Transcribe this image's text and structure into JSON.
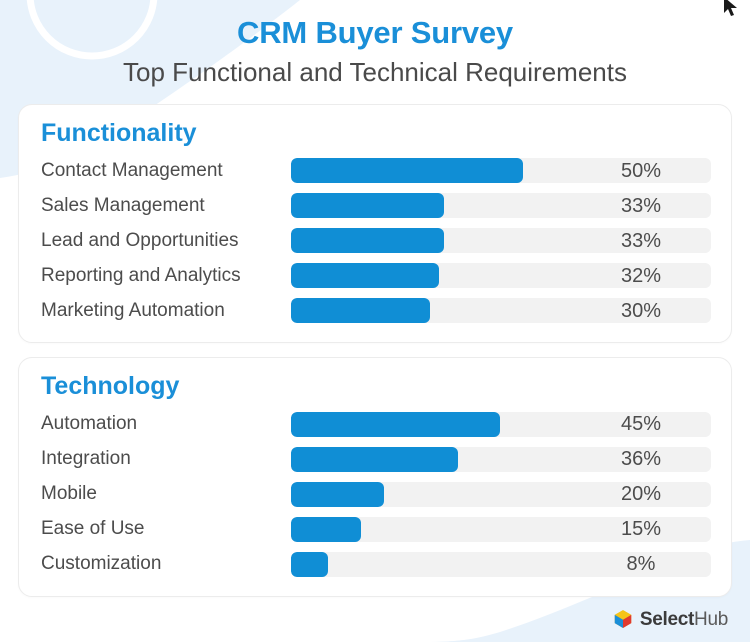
{
  "header": {
    "title": "CRM Buyer Survey",
    "subtitle": "Top Functional and Technical Requirements"
  },
  "colors": {
    "title_blue": "#1a8fd8",
    "bar_blue": "#108ed5",
    "track_gray": "#f2f2f2",
    "label_gray": "#4c4c4c",
    "background_blue": "#e8f2fb"
  },
  "sections": [
    {
      "heading": "Functionality",
      "rows": [
        {
          "label": "Contact Management",
          "value": 50,
          "value_label": "50%"
        },
        {
          "label": "Sales Management",
          "value": 33,
          "value_label": "33%"
        },
        {
          "label": "Lead and Opportunities",
          "value": 33,
          "value_label": "33%"
        },
        {
          "label": "Reporting and Analytics",
          "value": 32,
          "value_label": "32%"
        },
        {
          "label": "Marketing Automation",
          "value": 30,
          "value_label": "30%"
        }
      ]
    },
    {
      "heading": "Technology",
      "rows": [
        {
          "label": "Automation",
          "value": 45,
          "value_label": "45%"
        },
        {
          "label": "Integration",
          "value": 36,
          "value_label": "36%"
        },
        {
          "label": "Mobile",
          "value": 20,
          "value_label": "20%"
        },
        {
          "label": "Ease of Use",
          "value": 15,
          "value_label": "15%"
        },
        {
          "label": "Customization",
          "value": 8,
          "value_label": "8%"
        }
      ]
    }
  ],
  "footer": {
    "logo_mark": "selecthub-cube-icon",
    "brand_bold": "Select",
    "brand_light": "Hub"
  },
  "chart_data": {
    "type": "bar",
    "orientation": "horizontal",
    "title": "CRM Buyer Survey",
    "subtitle": "Top Functional and Technical Requirements",
    "xlabel": "",
    "ylabel": "",
    "xlim": [
      0,
      100
    ],
    "grid": false,
    "legend": false,
    "value_suffix": "%",
    "groups": [
      {
        "name": "Functionality",
        "categories": [
          "Contact Management",
          "Sales Management",
          "Lead and Opportunities",
          "Reporting and Analytics",
          "Marketing Automation"
        ],
        "values": [
          50,
          33,
          33,
          32,
          30
        ]
      },
      {
        "name": "Technology",
        "categories": [
          "Automation",
          "Integration",
          "Mobile",
          "Ease of Use",
          "Customization"
        ],
        "values": [
          45,
          36,
          20,
          15,
          8
        ]
      }
    ]
  }
}
